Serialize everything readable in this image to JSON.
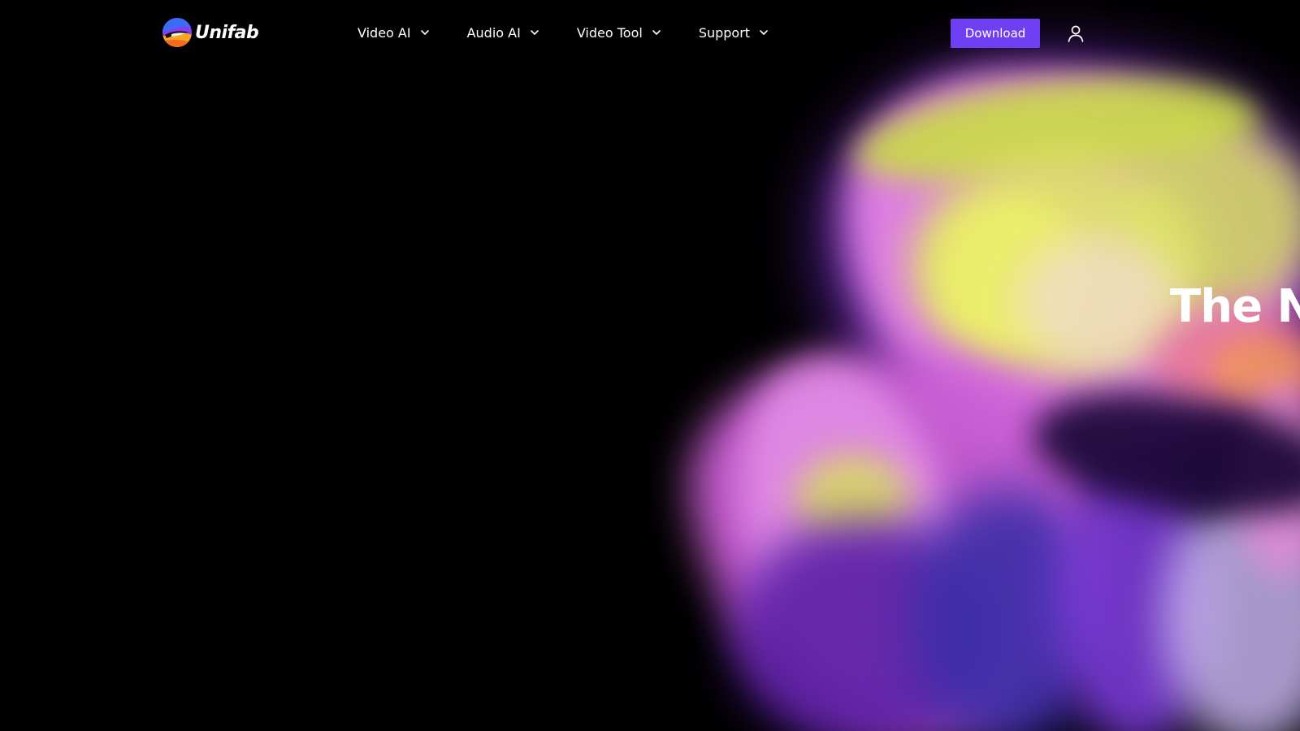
{
  "brand": {
    "name": "Unifab",
    "logo_icon": "unifab-logo-icon"
  },
  "nav": {
    "items": [
      {
        "label": "Video AI",
        "icon": "chevron-down-icon"
      },
      {
        "label": "Audio AI",
        "icon": "chevron-down-icon"
      },
      {
        "label": "Video Tool",
        "icon": "chevron-down-icon"
      },
      {
        "label": "Support",
        "icon": "chevron-down-icon"
      }
    ]
  },
  "header": {
    "download_label": "Download",
    "account_icon": "user-icon"
  },
  "hero": {
    "headline": "The N"
  },
  "colors": {
    "background": "#000000",
    "accent": "#6E3FF3",
    "text": "#FFFFFF"
  }
}
